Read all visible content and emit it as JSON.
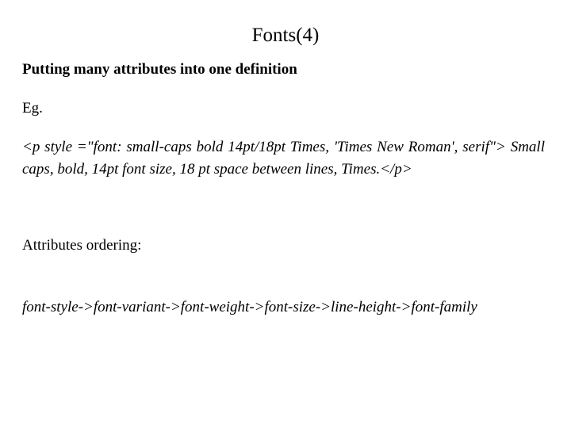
{
  "slide": {
    "title": "Fonts(4)",
    "heading": "Putting many attributes into one definition",
    "example_label": "Eg.",
    "example_code": "<p style =\"font: small-caps bold 14pt/18pt Times, 'Times New Roman', serif\"> Small caps, bold, 14pt font size, 18 pt space between lines, Times.</p>",
    "ordering_label": "Attributes ordering:",
    "ordering_value": "font-style->font-variant->font-weight->font-size->line-height->font-family"
  },
  "colors": {
    "background": "#ffffff",
    "text": "#000000"
  }
}
